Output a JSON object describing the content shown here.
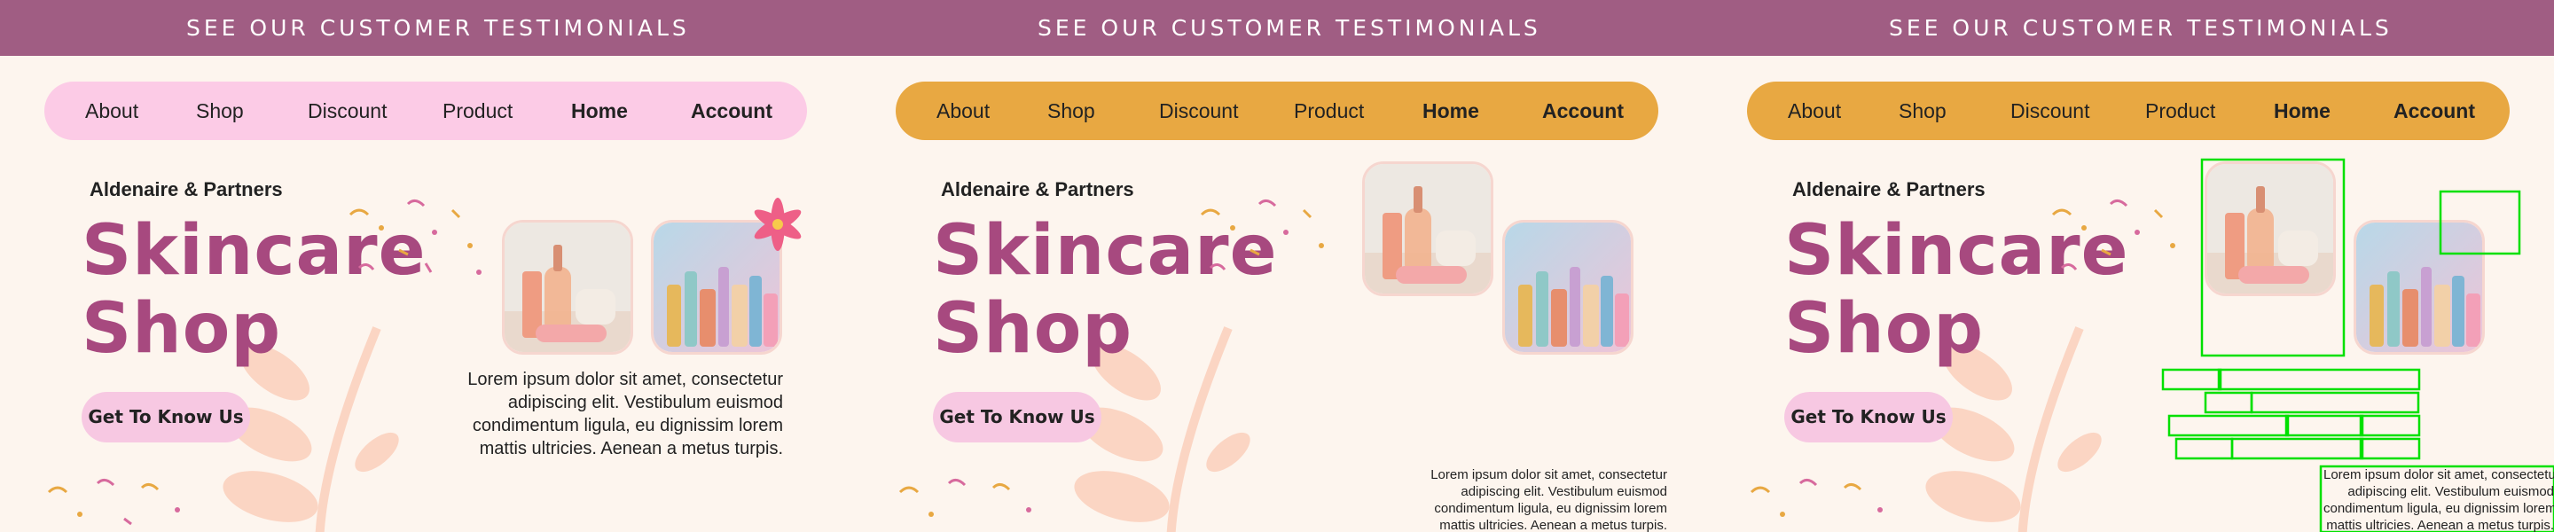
{
  "banner": "SEE OUR CUSTOMER TESTIMONIALS",
  "nav": [
    "About",
    "Shop",
    "Discount",
    "Product",
    "Home",
    "Account"
  ],
  "brand": "Aldenaire & Partners",
  "title_line1": "Skincare",
  "title_line2": "Shop",
  "cta": "Get To Know Us",
  "paragraph": [
    "Lorem ipsum dolor sit amet, consectetur",
    "adipiscing elit. Vestibulum euismod",
    "condimentum ligula, eu dignissim lorem",
    "mattis ultricies. Aenean a metus turpis."
  ],
  "colors": {
    "banner": "#a05d83",
    "nav_pink": "#fccbe6",
    "nav_orange": "#e8a842",
    "title": "#a7497f",
    "background": "#fdf5ee",
    "cta": "#f7c8e2",
    "leaf": "#fbd5c3",
    "highlight": "#00e000"
  },
  "icons": [
    "flower-icon",
    "leaf-decoration",
    "confetti-decoration"
  ]
}
